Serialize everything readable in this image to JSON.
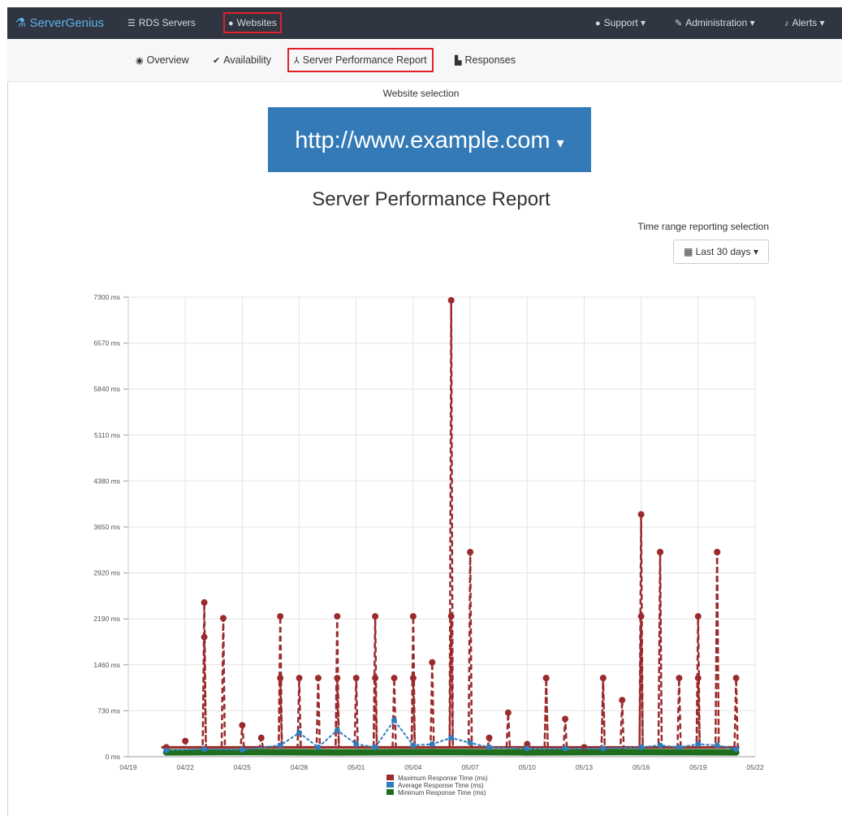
{
  "topnav": {
    "brand": "ServerGenius",
    "items": [
      {
        "label": "RDS Servers",
        "icon": "server-icon"
      },
      {
        "label": "Websites",
        "icon": "globe-icon",
        "highlighted": true
      }
    ],
    "right": [
      {
        "label": "Support",
        "icon": "question-circle-icon"
      },
      {
        "label": "Administration",
        "icon": "wrench-icon"
      },
      {
        "label": "Alerts",
        "icon": "bell-icon"
      }
    ]
  },
  "subnav": {
    "tabs": [
      {
        "label": "Overview",
        "icon": "eye-icon"
      },
      {
        "label": "Availability",
        "icon": "check-icon"
      },
      {
        "label": "Server Performance Report",
        "icon": "performance-icon",
        "highlighted": true
      },
      {
        "label": "Responses",
        "icon": "file-icon"
      }
    ]
  },
  "website_selection": {
    "label": "Website selection",
    "value": "http://www.example.com"
  },
  "report_title": "Server Performance Report",
  "time_range": {
    "label": "Time range reporting selection",
    "value": "Last 30 days"
  },
  "colors": {
    "max": "#9b2a2c",
    "avg": "#2f7dbd",
    "min": "#1e6e1e",
    "accent": "#337ab7",
    "highlight": "#e0202a"
  },
  "chart_data": {
    "type": "line",
    "title": "",
    "xlabel": "",
    "ylabel": "",
    "ylim": [
      0,
      7300
    ],
    "xlim": [
      "04/19",
      "05/22"
    ],
    "y_ticks": [
      "0 ms",
      "730 ms",
      "1460 ms",
      "2190 ms",
      "2920 ms",
      "3650 ms",
      "4380 ms",
      "5110 ms",
      "5840 ms",
      "6570 ms",
      "7300 ms"
    ],
    "x_ticks": [
      "04/19",
      "04/22",
      "04/25",
      "04/28",
      "05/01",
      "05/04",
      "05/07",
      "05/10",
      "05/13",
      "05/16",
      "05/19",
      "05/22"
    ],
    "grid": true,
    "legend": "bottom-center",
    "series": [
      {
        "name": "Maximum Response Time (ms)",
        "x": [
          "04/21",
          "04/22",
          "04/23",
          "04/23",
          "04/24",
          "04/25",
          "04/26",
          "04/27",
          "04/27",
          "04/28",
          "04/29",
          "04/30",
          "04/30",
          "05/01",
          "05/02",
          "05/02",
          "05/03",
          "05/04",
          "05/04",
          "05/05",
          "05/06",
          "05/06",
          "05/07",
          "05/08",
          "05/09",
          "05/10",
          "05/11",
          "05/11",
          "05/12",
          "05/13",
          "05/14",
          "05/14",
          "05/15",
          "05/16",
          "05/16",
          "05/17",
          "05/17",
          "05/18",
          "05/19",
          "05/19",
          "05/20",
          "05/20",
          "05/21"
        ],
        "values": [
          150,
          250,
          1900,
          2450,
          2200,
          500,
          300,
          1250,
          2230,
          1250,
          1250,
          1250,
          2230,
          1250,
          1250,
          2230,
          1250,
          1250,
          2230,
          1500,
          7250,
          2230,
          3250,
          300,
          700,
          200,
          1250,
          1250,
          600,
          150,
          1250,
          1250,
          900,
          3850,
          2230,
          3250,
          3250,
          1250,
          1250,
          2230,
          3250,
          3250,
          1250
        ]
      },
      {
        "name": "Average Response Time (ms)",
        "x": [
          "04/21",
          "04/23",
          "04/25",
          "04/27",
          "04/28",
          "04/29",
          "04/30",
          "05/01",
          "05/02",
          "05/03",
          "05/04",
          "05/05",
          "05/06",
          "05/07",
          "05/08",
          "05/10",
          "05/12",
          "05/14",
          "05/16",
          "05/17",
          "05/18",
          "05/19",
          "05/20",
          "05/21"
        ],
        "values": [
          100,
          120,
          110,
          180,
          380,
          150,
          420,
          200,
          150,
          580,
          180,
          200,
          300,
          220,
          150,
          130,
          130,
          130,
          150,
          180,
          150,
          200,
          180,
          120
        ]
      },
      {
        "name": "Minimum Response Time (ms)",
        "x": [
          "04/21",
          "04/25",
          "04/30",
          "05/05",
          "05/10",
          "05/15",
          "05/21"
        ],
        "values": [
          70,
          75,
          70,
          75,
          70,
          75,
          70
        ]
      }
    ]
  }
}
